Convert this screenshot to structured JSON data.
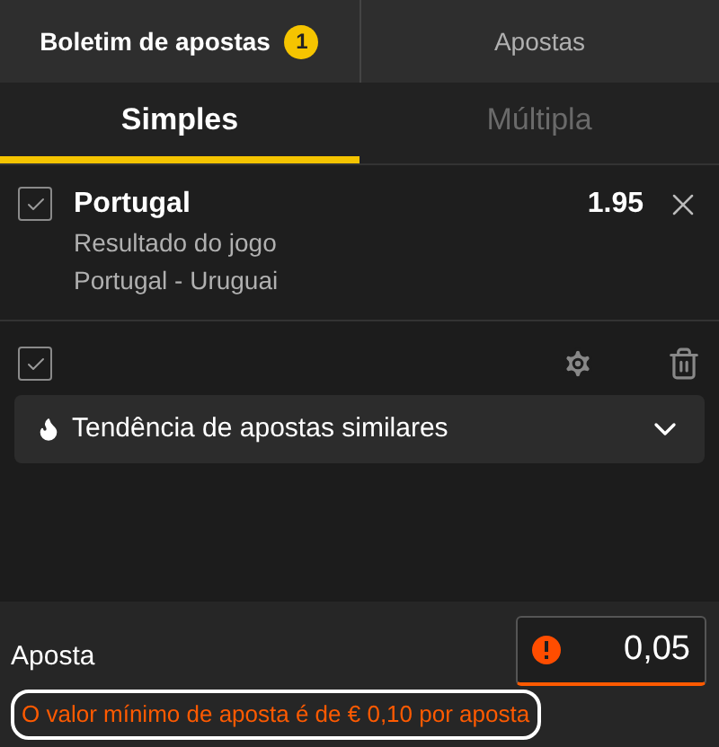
{
  "top_tabs": [
    {
      "label": "Boletim de apostas",
      "badge": "1",
      "selected": true
    },
    {
      "label": "Apostas",
      "selected": false
    }
  ],
  "bet_type_tabs": [
    {
      "label": "Simples",
      "selected": true
    },
    {
      "label": "Múltipla",
      "selected": false
    }
  ],
  "selection": {
    "checked": true,
    "team": "Portugal",
    "market": "Resultado do jogo",
    "event": "Portugal - Uruguai",
    "odds": "1.95"
  },
  "toolbar": {
    "select_all_checked": true
  },
  "trend": {
    "label": "Tendência de apostas similares",
    "expanded": false
  },
  "stake": {
    "label": "Aposta",
    "value": "0,05",
    "error": "O valor mínimo de aposta é de € 0,10 por aposta"
  }
}
